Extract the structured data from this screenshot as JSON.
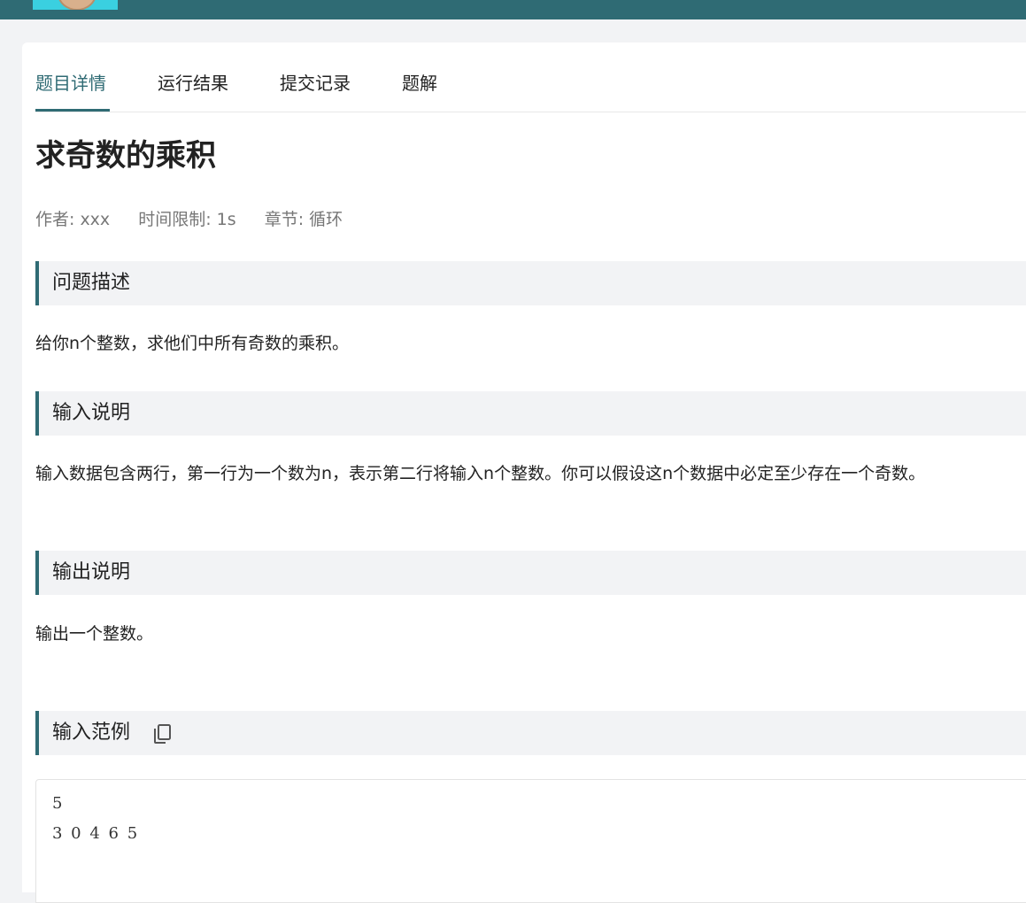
{
  "tabs": [
    {
      "label": "题目详情",
      "active": true
    },
    {
      "label": "运行结果",
      "active": false
    },
    {
      "label": "提交记录",
      "active": false
    },
    {
      "label": "题解",
      "active": false
    }
  ],
  "problem": {
    "title": "求奇数的乘积",
    "author": "作者: xxx",
    "time_limit": "时间限制: 1s",
    "chapter": "章节: 循环"
  },
  "sections": {
    "description": {
      "heading": "问题描述",
      "text": "给你n个整数，求他们中所有奇数的乘积。"
    },
    "input": {
      "heading": "输入说明",
      "text": "输入数据包含两行，第一行为一个数为n，表示第二行将输入n个整数。你可以假设这n个数据中必定至少存在一个奇数。"
    },
    "output": {
      "heading": "输出说明",
      "text": "输出一个整数。"
    },
    "sample_input": {
      "heading": "输入范例",
      "lines": [
        "5",
        "3 0 4 6 5"
      ]
    }
  },
  "colors": {
    "accent": "#2f6b74",
    "section_bg": "#f2f3f5"
  },
  "icons": {
    "copy": "copy-icon"
  }
}
